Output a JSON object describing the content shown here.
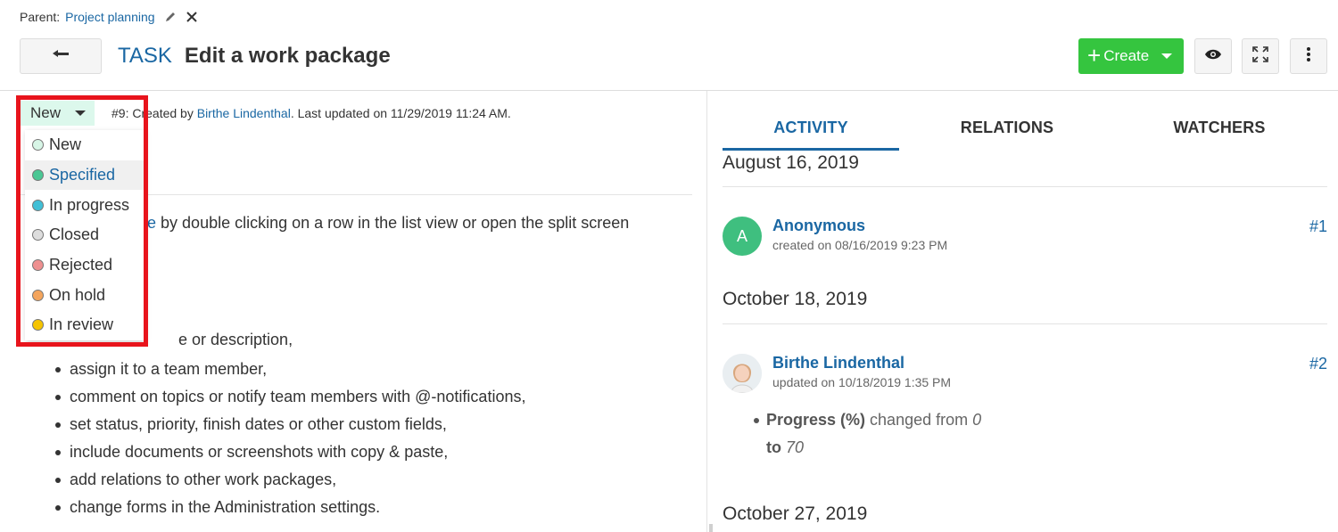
{
  "breadcrumb": {
    "label": "Parent:",
    "parent": "Project planning"
  },
  "header": {
    "back_icon": "back-arrow-icon",
    "type": "TASK",
    "subject": "Edit a work package"
  },
  "toolbar": {
    "create_label": "Create",
    "accent": "#35c53f"
  },
  "status": {
    "current": "New",
    "meta_prefix": "#9: Created by ",
    "meta_author": "Birthe Lindenthal",
    "meta_suffix": ". Last updated on 11/29/2019 11:24 AM.",
    "options": [
      {
        "label": "New",
        "color": "#d7f5e6"
      },
      {
        "label": "Specified",
        "color": "#4ac794"
      },
      {
        "label": "In progress",
        "color": "#41bfd6"
      },
      {
        "label": "Closed",
        "color": "#dddddd"
      },
      {
        "label": "Rejected",
        "color": "#ee9090"
      },
      {
        "label": "On hold",
        "color": "#f4a55d"
      },
      {
        "label": "In review",
        "color": "#f5c400"
      }
    ],
    "hovered": "Specified"
  },
  "description": {
    "link_part": "ge",
    "line_rest": " by double clicking on a row in the list view or open the split screen",
    "partial_bullet": "e or description,",
    "bullets": [
      "assign it to a team member,",
      "comment on topics or notify team members with @-notifications,",
      "set status, priority, finish dates or other custom fields,",
      "include documents or screenshots with copy & paste,",
      "add relations to other work packages,",
      "change forms in the Administration settings."
    ]
  },
  "tabs": [
    {
      "label": "ACTIVITY",
      "active": true
    },
    {
      "label": "RELATIONS",
      "active": false
    },
    {
      "label": "WATCHERS",
      "active": false
    }
  ],
  "activity": {
    "dates": [
      "August 16, 2019",
      "October 18, 2019",
      "October 27, 2019"
    ],
    "entries": [
      {
        "initial": "A",
        "author": "Anonymous",
        "stamp": "created on 08/16/2019 9:23 PM",
        "anchor": "#1"
      },
      {
        "author": "Birthe Lindenthal",
        "stamp": "updated on 10/18/2019 1:35 PM",
        "anchor": "#2",
        "change_field": "Progress (%)",
        "change_text": " changed from ",
        "from": "0",
        "to_label": "to",
        "to": "70"
      }
    ]
  }
}
